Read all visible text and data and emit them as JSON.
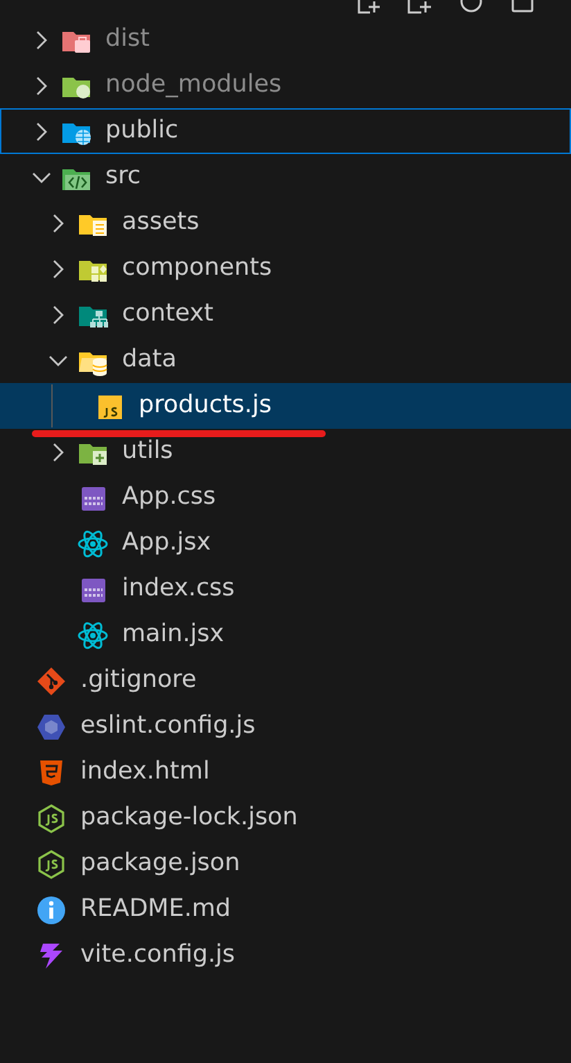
{
  "tree": [
    {
      "name": "dist",
      "kind": "dist",
      "expanded": false,
      "selected": false,
      "focused": false,
      "ignored": true
    },
    {
      "name": "node_modules",
      "kind": "modules",
      "expanded": false,
      "selected": false,
      "focused": false,
      "ignored": true
    },
    {
      "name": "public",
      "kind": "public",
      "expanded": false,
      "selected": false,
      "focused": true,
      "ignored": false
    },
    {
      "name": "src",
      "kind": "src",
      "expanded": true,
      "selected": false,
      "focused": false,
      "ignored": false,
      "children": [
        {
          "name": "assets",
          "kind": "assets",
          "expanded": false,
          "selected": false,
          "focused": false,
          "ignored": false
        },
        {
          "name": "components",
          "kind": "components",
          "expanded": false,
          "selected": false,
          "focused": false,
          "ignored": false
        },
        {
          "name": "context",
          "kind": "context",
          "expanded": false,
          "selected": false,
          "focused": false,
          "ignored": false
        },
        {
          "name": "data",
          "kind": "data",
          "expanded": true,
          "selected": false,
          "focused": false,
          "ignored": false,
          "children": [
            {
              "name": "products.js",
              "kind": "js",
              "selected": true,
              "focused": false,
              "ignored": false,
              "underlined": true
            }
          ]
        },
        {
          "name": "utils",
          "kind": "utils",
          "expanded": false,
          "selected": false,
          "focused": false,
          "ignored": false
        },
        {
          "name": "App.css",
          "kind": "css",
          "selected": false,
          "focused": false,
          "ignored": false
        },
        {
          "name": "App.jsx",
          "kind": "react",
          "selected": false,
          "focused": false,
          "ignored": false
        },
        {
          "name": "index.css",
          "kind": "css",
          "selected": false,
          "focused": false,
          "ignored": false
        },
        {
          "name": "main.jsx",
          "kind": "react",
          "selected": false,
          "focused": false,
          "ignored": false
        }
      ]
    },
    {
      "name": ".gitignore",
      "kind": "git",
      "selected": false,
      "focused": false,
      "ignored": false
    },
    {
      "name": "eslint.config.js",
      "kind": "eslint",
      "selected": false,
      "focused": false,
      "ignored": false
    },
    {
      "name": "index.html",
      "kind": "html",
      "selected": false,
      "focused": false,
      "ignored": false
    },
    {
      "name": "package-lock.json",
      "kind": "npm",
      "selected": false,
      "focused": false,
      "ignored": false
    },
    {
      "name": "package.json",
      "kind": "npm",
      "selected": false,
      "focused": false,
      "ignored": false
    },
    {
      "name": "README.md",
      "kind": "info",
      "selected": false,
      "focused": false,
      "ignored": false
    },
    {
      "name": "vite.config.js",
      "kind": "vite",
      "selected": false,
      "focused": false,
      "ignored": false
    }
  ]
}
